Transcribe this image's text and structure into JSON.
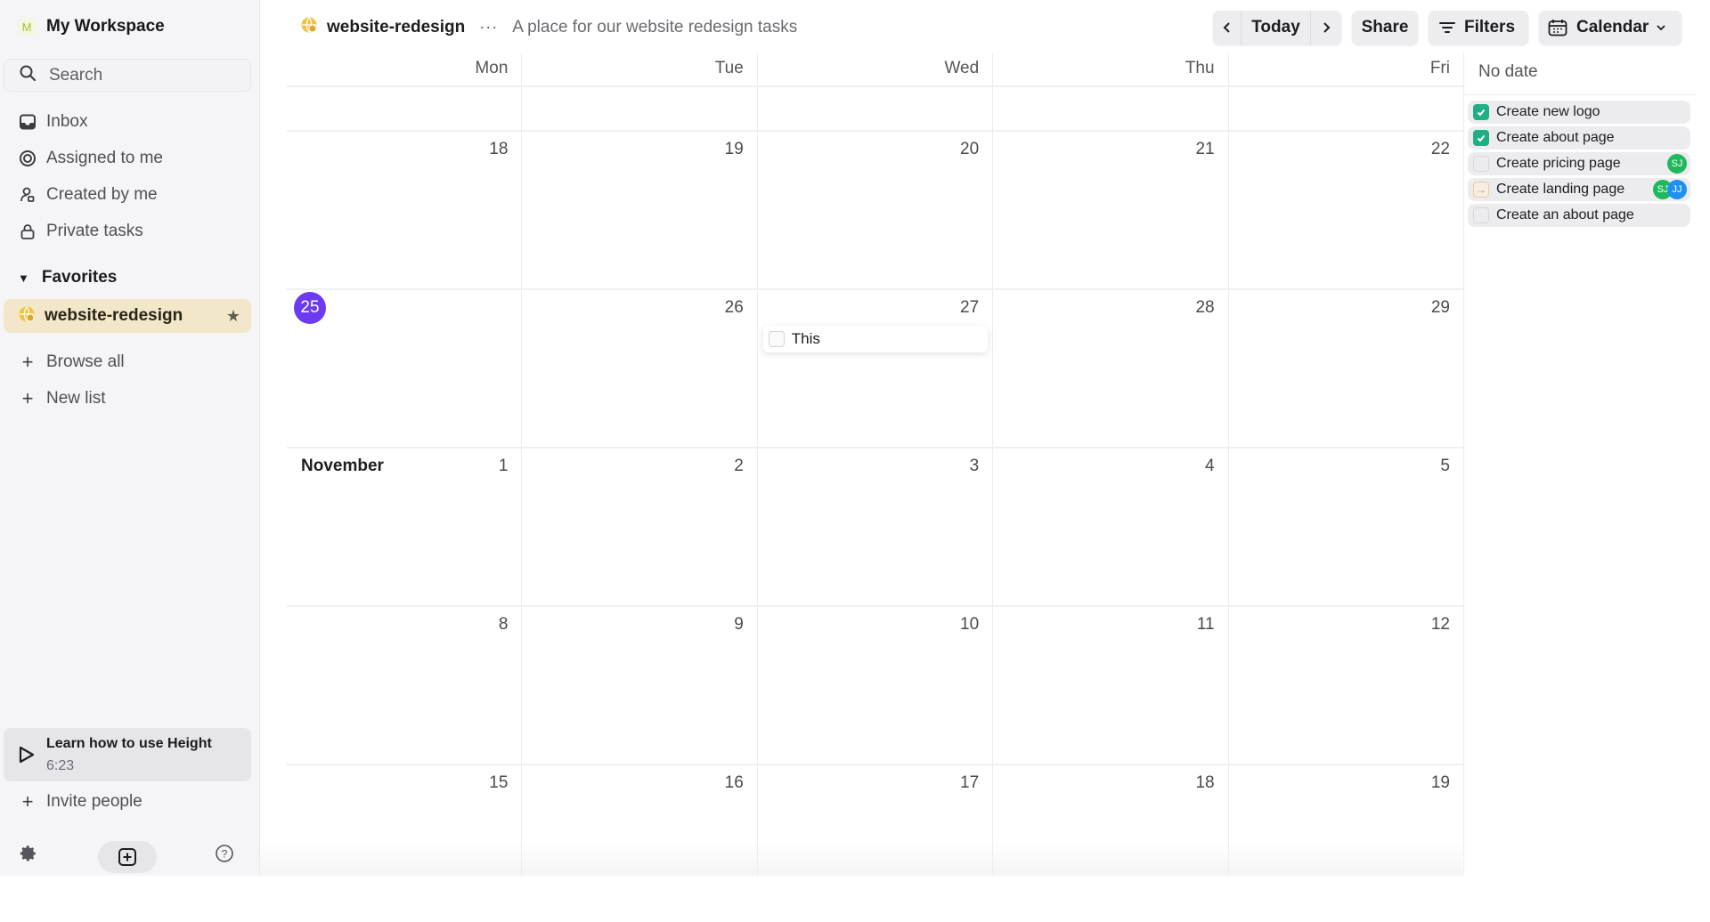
{
  "sidebar": {
    "workspace": {
      "initial": "M",
      "name": "My Workspace"
    },
    "search": {
      "placeholder": "Search"
    },
    "nav": [
      {
        "label": "Inbox",
        "icon": "inbox-icon"
      },
      {
        "label": "Assigned to me",
        "icon": "target-icon"
      },
      {
        "label": "Created by me",
        "icon": "user-icon"
      },
      {
        "label": "Private tasks",
        "icon": "lock-icon"
      }
    ],
    "favorites": {
      "heading": "Favorites",
      "items": [
        {
          "label": "website-redesign",
          "icon": "globe-icon",
          "starred": true
        }
      ]
    },
    "actions": [
      {
        "label": "Browse all",
        "icon": "plus-icon"
      },
      {
        "label": "New list",
        "icon": "plus-icon"
      }
    ],
    "learn": {
      "title": "Learn how to use Height",
      "duration": "6:23"
    },
    "invite": {
      "label": "Invite people"
    }
  },
  "header": {
    "project_name": "website-redesign",
    "project_description": "A place for our website redesign tasks",
    "more_label": "···",
    "today_label": "Today",
    "share_label": "Share",
    "filters_label": "Filters",
    "view_label": "Calendar"
  },
  "calendar": {
    "weekdays": [
      "Mon",
      "Tue",
      "Wed",
      "Thu",
      "Fri"
    ],
    "weeks": [
      {
        "month_label": "",
        "days": [
          "",
          "",
          "",
          "",
          ""
        ]
      },
      {
        "month_label": "",
        "days": [
          "18",
          "19",
          "20",
          "21",
          "22"
        ]
      },
      {
        "month_label": "",
        "days": [
          "25",
          "26",
          "27",
          "28",
          "29"
        ],
        "today_index": 0
      },
      {
        "month_label": "November",
        "days": [
          "1",
          "2",
          "3",
          "4",
          "5"
        ]
      },
      {
        "month_label": "",
        "days": [
          "8",
          "9",
          "10",
          "11",
          "12"
        ]
      },
      {
        "month_label": "",
        "days": [
          "15",
          "16",
          "17",
          "18",
          "19"
        ]
      }
    ],
    "new_task_input": {
      "value": "This",
      "day": "27"
    },
    "today_color": "#6c3bf0"
  },
  "no_date": {
    "title": "No date",
    "tasks": [
      {
        "label": "Create new logo",
        "status": "done",
        "assignees": []
      },
      {
        "label": "Create about page",
        "status": "done",
        "assignees": []
      },
      {
        "label": "Create pricing page",
        "status": "open",
        "assignees": [
          {
            "initials": "SJ",
            "color": "#1fb85a"
          }
        ]
      },
      {
        "label": "Create landing page",
        "status": "in-progress",
        "assignees": [
          {
            "initials": "SJ",
            "color": "#1fb85a"
          },
          {
            "initials": "JJ",
            "color": "#1e90f0"
          }
        ]
      },
      {
        "label": "Create an about page",
        "status": "open",
        "assignees": []
      }
    ]
  }
}
